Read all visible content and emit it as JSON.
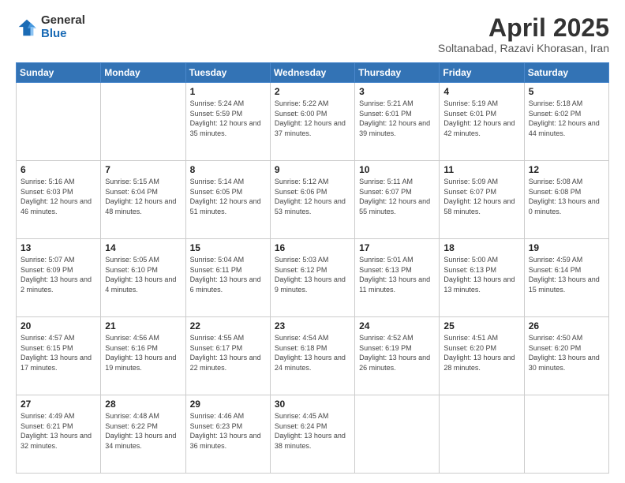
{
  "logo": {
    "general": "General",
    "blue": "Blue"
  },
  "header": {
    "title": "April 2025",
    "subtitle": "Soltanabad, Razavi Khorasan, Iran"
  },
  "weekdays": [
    "Sunday",
    "Monday",
    "Tuesday",
    "Wednesday",
    "Thursday",
    "Friday",
    "Saturday"
  ],
  "weeks": [
    [
      {
        "day": "",
        "info": ""
      },
      {
        "day": "",
        "info": ""
      },
      {
        "day": "1",
        "info": "Sunrise: 5:24 AM\nSunset: 5:59 PM\nDaylight: 12 hours and 35 minutes."
      },
      {
        "day": "2",
        "info": "Sunrise: 5:22 AM\nSunset: 6:00 PM\nDaylight: 12 hours and 37 minutes."
      },
      {
        "day": "3",
        "info": "Sunrise: 5:21 AM\nSunset: 6:01 PM\nDaylight: 12 hours and 39 minutes."
      },
      {
        "day": "4",
        "info": "Sunrise: 5:19 AM\nSunset: 6:01 PM\nDaylight: 12 hours and 42 minutes."
      },
      {
        "day": "5",
        "info": "Sunrise: 5:18 AM\nSunset: 6:02 PM\nDaylight: 12 hours and 44 minutes."
      }
    ],
    [
      {
        "day": "6",
        "info": "Sunrise: 5:16 AM\nSunset: 6:03 PM\nDaylight: 12 hours and 46 minutes."
      },
      {
        "day": "7",
        "info": "Sunrise: 5:15 AM\nSunset: 6:04 PM\nDaylight: 12 hours and 48 minutes."
      },
      {
        "day": "8",
        "info": "Sunrise: 5:14 AM\nSunset: 6:05 PM\nDaylight: 12 hours and 51 minutes."
      },
      {
        "day": "9",
        "info": "Sunrise: 5:12 AM\nSunset: 6:06 PM\nDaylight: 12 hours and 53 minutes."
      },
      {
        "day": "10",
        "info": "Sunrise: 5:11 AM\nSunset: 6:07 PM\nDaylight: 12 hours and 55 minutes."
      },
      {
        "day": "11",
        "info": "Sunrise: 5:09 AM\nSunset: 6:07 PM\nDaylight: 12 hours and 58 minutes."
      },
      {
        "day": "12",
        "info": "Sunrise: 5:08 AM\nSunset: 6:08 PM\nDaylight: 13 hours and 0 minutes."
      }
    ],
    [
      {
        "day": "13",
        "info": "Sunrise: 5:07 AM\nSunset: 6:09 PM\nDaylight: 13 hours and 2 minutes."
      },
      {
        "day": "14",
        "info": "Sunrise: 5:05 AM\nSunset: 6:10 PM\nDaylight: 13 hours and 4 minutes."
      },
      {
        "day": "15",
        "info": "Sunrise: 5:04 AM\nSunset: 6:11 PM\nDaylight: 13 hours and 6 minutes."
      },
      {
        "day": "16",
        "info": "Sunrise: 5:03 AM\nSunset: 6:12 PM\nDaylight: 13 hours and 9 minutes."
      },
      {
        "day": "17",
        "info": "Sunrise: 5:01 AM\nSunset: 6:13 PM\nDaylight: 13 hours and 11 minutes."
      },
      {
        "day": "18",
        "info": "Sunrise: 5:00 AM\nSunset: 6:13 PM\nDaylight: 13 hours and 13 minutes."
      },
      {
        "day": "19",
        "info": "Sunrise: 4:59 AM\nSunset: 6:14 PM\nDaylight: 13 hours and 15 minutes."
      }
    ],
    [
      {
        "day": "20",
        "info": "Sunrise: 4:57 AM\nSunset: 6:15 PM\nDaylight: 13 hours and 17 minutes."
      },
      {
        "day": "21",
        "info": "Sunrise: 4:56 AM\nSunset: 6:16 PM\nDaylight: 13 hours and 19 minutes."
      },
      {
        "day": "22",
        "info": "Sunrise: 4:55 AM\nSunset: 6:17 PM\nDaylight: 13 hours and 22 minutes."
      },
      {
        "day": "23",
        "info": "Sunrise: 4:54 AM\nSunset: 6:18 PM\nDaylight: 13 hours and 24 minutes."
      },
      {
        "day": "24",
        "info": "Sunrise: 4:52 AM\nSunset: 6:19 PM\nDaylight: 13 hours and 26 minutes."
      },
      {
        "day": "25",
        "info": "Sunrise: 4:51 AM\nSunset: 6:20 PM\nDaylight: 13 hours and 28 minutes."
      },
      {
        "day": "26",
        "info": "Sunrise: 4:50 AM\nSunset: 6:20 PM\nDaylight: 13 hours and 30 minutes."
      }
    ],
    [
      {
        "day": "27",
        "info": "Sunrise: 4:49 AM\nSunset: 6:21 PM\nDaylight: 13 hours and 32 minutes."
      },
      {
        "day": "28",
        "info": "Sunrise: 4:48 AM\nSunset: 6:22 PM\nDaylight: 13 hours and 34 minutes."
      },
      {
        "day": "29",
        "info": "Sunrise: 4:46 AM\nSunset: 6:23 PM\nDaylight: 13 hours and 36 minutes."
      },
      {
        "day": "30",
        "info": "Sunrise: 4:45 AM\nSunset: 6:24 PM\nDaylight: 13 hours and 38 minutes."
      },
      {
        "day": "",
        "info": ""
      },
      {
        "day": "",
        "info": ""
      },
      {
        "day": "",
        "info": ""
      }
    ]
  ]
}
